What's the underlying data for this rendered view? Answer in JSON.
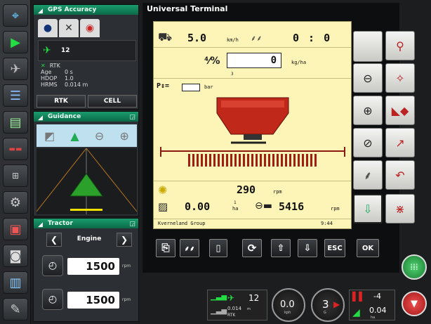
{
  "gps": {
    "title": "GPS Accuracy",
    "satellites": "12",
    "mode": "RTK",
    "age_label": "Age",
    "age_value": "0 s",
    "hdop_label": "HDOP",
    "hdop_value": "1.0",
    "hrms_label": "HRMS",
    "hrms_value": "0.014 m",
    "btn_rtk": "RTK",
    "btn_cell": "CELL"
  },
  "guidance": {
    "title": "Guidance"
  },
  "tractor": {
    "title": "Tractor",
    "selector_label": "Engine",
    "rpm1": "1500",
    "rpm1_unit": "rpm",
    "rpm2": "1500",
    "rpm2_unit": "rpm"
  },
  "ut": {
    "title": "Universal Terminal",
    "speed_value": "5.0",
    "speed_unit": "km/h",
    "rate_actual": "0 : 0",
    "rate_setpoint": "0",
    "rate_unit": "kg/ha",
    "rate_sub": "3",
    "pressure_label": "P↕=",
    "pressure_unit": "bar",
    "fan_value": "290",
    "fan_unit": "rpm",
    "area_value": "0.00",
    "area_unit": "ha",
    "area_sup": "1",
    "shaft_value": "5416",
    "shaft_unit": "rpm",
    "brand": "Kverneland Group",
    "time": "9:44",
    "btn_esc": "ESC",
    "btn_ok": "OK"
  },
  "status": {
    "satellites": "12",
    "accuracy": "0.014",
    "accuracy_unit": "m",
    "mode": "RTK",
    "speed": "0.0",
    "speed_unit": "kph",
    "gear": "3",
    "gear_unit": "G",
    "value_top": "-4",
    "value_bottom": "0.04",
    "value_bottom_unit": "ha"
  },
  "colors": {
    "accent": "#12a06e",
    "panel": "#2c2f33",
    "yellow": "#fdf5b8",
    "red": "#c0281a"
  }
}
